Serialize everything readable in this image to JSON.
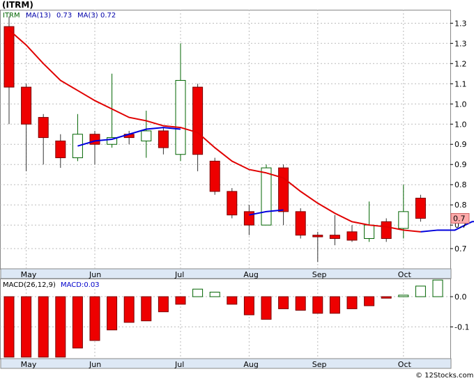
{
  "header": {
    "title": "(ITRM)"
  },
  "watermark": "© 12Stocks.com",
  "colors": {
    "up_fill": "#ffffff",
    "up_stroke": "#006400",
    "down_fill": "#ee0000",
    "down_stroke": "#7a0000",
    "ma13": "#e00000",
    "ma3": "#0000dd",
    "panel_bg": "#ffffff",
    "axis_bar": "#dde8f5",
    "last_label_bg": "#ffaaaa"
  },
  "chart_data": [
    {
      "type": "candlestick",
      "legend": {
        "symbol": "ITRM",
        "ma13_label": "MA(13)",
        "ma13_value": "0.73",
        "ma3_label": "MA(3)",
        "ma3_value": "0.72"
      },
      "x_labels": [
        "May",
        "Jun",
        "Jul",
        "Aug",
        "Sep",
        "Oct"
      ],
      "x_label_index": [
        1,
        5,
        10,
        14,
        18,
        23
      ],
      "y_ticks": [
        {
          "label": "1.3",
          "value": 1.39
        },
        {
          "label": "1.3",
          "value": 1.33
        },
        {
          "label": "1.2",
          "value": 1.27
        },
        {
          "label": "1.1",
          "value": 1.21
        },
        {
          "label": "1.0",
          "value": 1.15
        },
        {
          "label": "1.0",
          "value": 1.09
        },
        {
          "label": "0.9",
          "value": 1.03
        },
        {
          "label": "0.9",
          "value": 0.97
        },
        {
          "label": "0.8",
          "value": 0.91
        },
        {
          "label": "0.8",
          "value": 0.85
        },
        {
          "label": "0.7",
          "value": 0.79
        },
        {
          "label": "0.7",
          "value": 0.72
        }
      ],
      "ylim": [
        0.66,
        1.43
      ],
      "last_value_label": "0.7",
      "last_value": 0.81,
      "candles": [
        {
          "o": 1.38,
          "h": 1.41,
          "l": 1.09,
          "c": 1.2
        },
        {
          "o": 1.2,
          "h": 1.21,
          "l": 0.95,
          "c": 1.09
        },
        {
          "o": 1.11,
          "h": 1.12,
          "l": 0.97,
          "c": 1.05
        },
        {
          "o": 1.04,
          "h": 1.06,
          "l": 0.96,
          "c": 0.99
        },
        {
          "o": 0.99,
          "h": 1.12,
          "l": 0.98,
          "c": 1.06
        },
        {
          "o": 1.06,
          "h": 1.07,
          "l": 0.97,
          "c": 1.03
        },
        {
          "o": 1.03,
          "h": 1.24,
          "l": 1.02,
          "c": 1.05
        },
        {
          "o": 1.06,
          "h": 1.07,
          "l": 1.03,
          "c": 1.05
        },
        {
          "o": 1.04,
          "h": 1.13,
          "l": 0.99,
          "c": 1.07
        },
        {
          "o": 1.07,
          "h": 1.08,
          "l": 1.0,
          "c": 1.02
        },
        {
          "o": 1.0,
          "h": 1.33,
          "l": 0.98,
          "c": 1.22
        },
        {
          "o": 1.2,
          "h": 1.21,
          "l": 0.95,
          "c": 1.0
        },
        {
          "o": 0.98,
          "h": 0.99,
          "l": 0.88,
          "c": 0.89
        },
        {
          "o": 0.89,
          "h": 0.9,
          "l": 0.81,
          "c": 0.82
        },
        {
          "o": 0.83,
          "h": 0.85,
          "l": 0.76,
          "c": 0.79
        },
        {
          "o": 0.79,
          "h": 0.97,
          "l": 0.79,
          "c": 0.96
        },
        {
          "o": 0.96,
          "h": 0.97,
          "l": 0.79,
          "c": 0.83
        },
        {
          "o": 0.83,
          "h": 0.84,
          "l": 0.75,
          "c": 0.76
        },
        {
          "o": 0.76,
          "h": 0.77,
          "l": 0.68,
          "c": 0.755
        },
        {
          "o": 0.76,
          "h": 0.82,
          "l": 0.73,
          "c": 0.75
        },
        {
          "o": 0.77,
          "h": 0.79,
          "l": 0.74,
          "c": 0.745
        },
        {
          "o": 0.75,
          "h": 0.86,
          "l": 0.74,
          "c": 0.79
        },
        {
          "o": 0.8,
          "h": 0.81,
          "l": 0.74,
          "c": 0.75
        },
        {
          "o": 0.78,
          "h": 0.91,
          "l": 0.75,
          "c": 0.83
        },
        {
          "o": 0.87,
          "h": 0.88,
          "l": 0.8,
          "c": 0.81
        }
      ],
      "ma13": [
        1.37,
        1.325,
        1.27,
        1.22,
        1.19,
        1.16,
        1.135,
        1.11,
        1.1,
        1.085,
        1.08,
        1.065,
        1.02,
        0.98,
        0.955,
        0.945,
        0.93,
        0.89,
        0.855,
        0.825,
        0.8,
        0.79,
        0.785,
        0.775,
        0.77
      ],
      "ma3_start": 4,
      "ma3": [
        1.025,
        1.04,
        1.045,
        1.06,
        1.075,
        1.08,
        1.075,
        null,
        null,
        null,
        0.82,
        0.83,
        0.835,
        null,
        null,
        null,
        null,
        null,
        null,
        null,
        0.77,
        0.775,
        0.775,
        0.8,
        0.805
      ]
    },
    {
      "type": "bar",
      "legend": {
        "label": "MACD(26,12,9)",
        "value_label": "MACD:0.03"
      },
      "y_ticks": [
        {
          "label": "0.0",
          "value": 0.0
        },
        {
          "label": "-0.1",
          "value": -0.1
        }
      ],
      "ylim": [
        -0.205,
        0.06
      ],
      "values": [
        -0.2,
        -0.2,
        -0.2,
        -0.2,
        -0.17,
        -0.145,
        -0.11,
        -0.085,
        -0.08,
        -0.05,
        -0.025,
        0.025,
        0.015,
        -0.025,
        -0.06,
        -0.075,
        -0.04,
        -0.045,
        -0.055,
        -0.055,
        -0.04,
        -0.03,
        -0.005,
        0.005,
        0.035,
        0.055
      ]
    }
  ]
}
